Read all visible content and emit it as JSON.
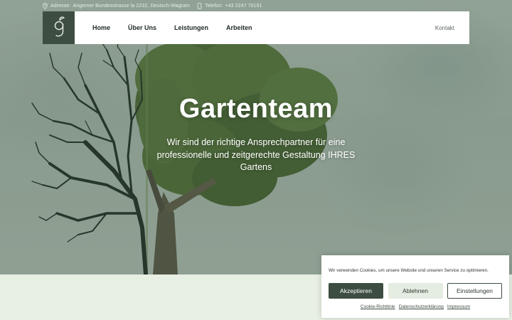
{
  "topbar": {
    "address_label": "Adresse:",
    "address_value": "Angerner Bundesstrasse la 2232, Deutsch-Wagram",
    "phone_label": "Telefon:",
    "phone_value": "+43 2247 70161"
  },
  "nav": {
    "logo_letter": "g",
    "links": [
      "Home",
      "Über Uns",
      "Leistungen",
      "Arbeiten"
    ],
    "contact": "Kontakt"
  },
  "hero": {
    "title": "Gartenteam",
    "subtitle": "Wir sind der richtige Ansprechpartner für eine professionelle und zeitgerechte Gestaltung IHRES Gartens"
  },
  "cookie": {
    "text": "Wir verwenden Cookies, um unsere Website und unseren Service zu optimieren.",
    "accept": "Akzeptieren",
    "deny": "Ablehnen",
    "settings": "Einstellungen",
    "links": [
      "Cookie-Richtlinie",
      "Datenschutzerklärung",
      "Impressum"
    ]
  },
  "colors": {
    "brand_dark": "#3d4d41",
    "brand_light": "#e5ece1"
  }
}
